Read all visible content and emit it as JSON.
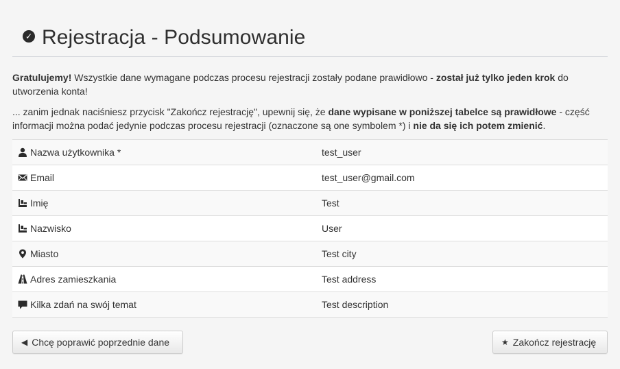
{
  "header": {
    "title": "Rejestracja - Podsumowanie",
    "icon": "check-circle-icon"
  },
  "intro": {
    "p1_bold_start": "Gratulujemy!",
    "p1_text": " Wszystkie dane wymagane podczas procesu rejestracji zostały podane prawidłowo - ",
    "p1_bold_mid": "został już tylko jeden krok",
    "p1_end": " do utworzenia konta!",
    "p2_text": "... zanim jednak naciśniesz przycisk \"Zakończ rejestrację\", upewnij się, że ",
    "p2_bold_1": "dane wypisane w poniższej tabelce są prawidłowe",
    "p2_mid": " - część informacji można podać jedynie podczas procesu rejestracji (oznaczone są one symbolem *) i ",
    "p2_bold_2": "nie da się ich potem zmienić",
    "p2_end": "."
  },
  "table": {
    "rows": [
      {
        "icon": "user-icon",
        "label": "Nazwa użytkownika *",
        "value": "test_user"
      },
      {
        "icon": "envelope-icon",
        "label": "Email",
        "value": "test_user@gmail.com"
      },
      {
        "icon": "id-card-icon",
        "label": "Imię",
        "value": "Test"
      },
      {
        "icon": "id-card-icon",
        "label": "Nazwisko",
        "value": "User"
      },
      {
        "icon": "map-marker-icon",
        "label": "Miasto",
        "value": "Test city"
      },
      {
        "icon": "road-icon",
        "label": "Adres zamieszkania",
        "value": "Test address"
      },
      {
        "icon": "comment-icon",
        "label": "Kilka zdań na swój temat",
        "value": "Test description"
      }
    ]
  },
  "buttons": {
    "back_label": "Chcę poprawić poprzednie dane",
    "back_icon": "caret-left-icon",
    "finish_label": "Zakończ rejestrację",
    "finish_icon": "star-icon"
  }
}
